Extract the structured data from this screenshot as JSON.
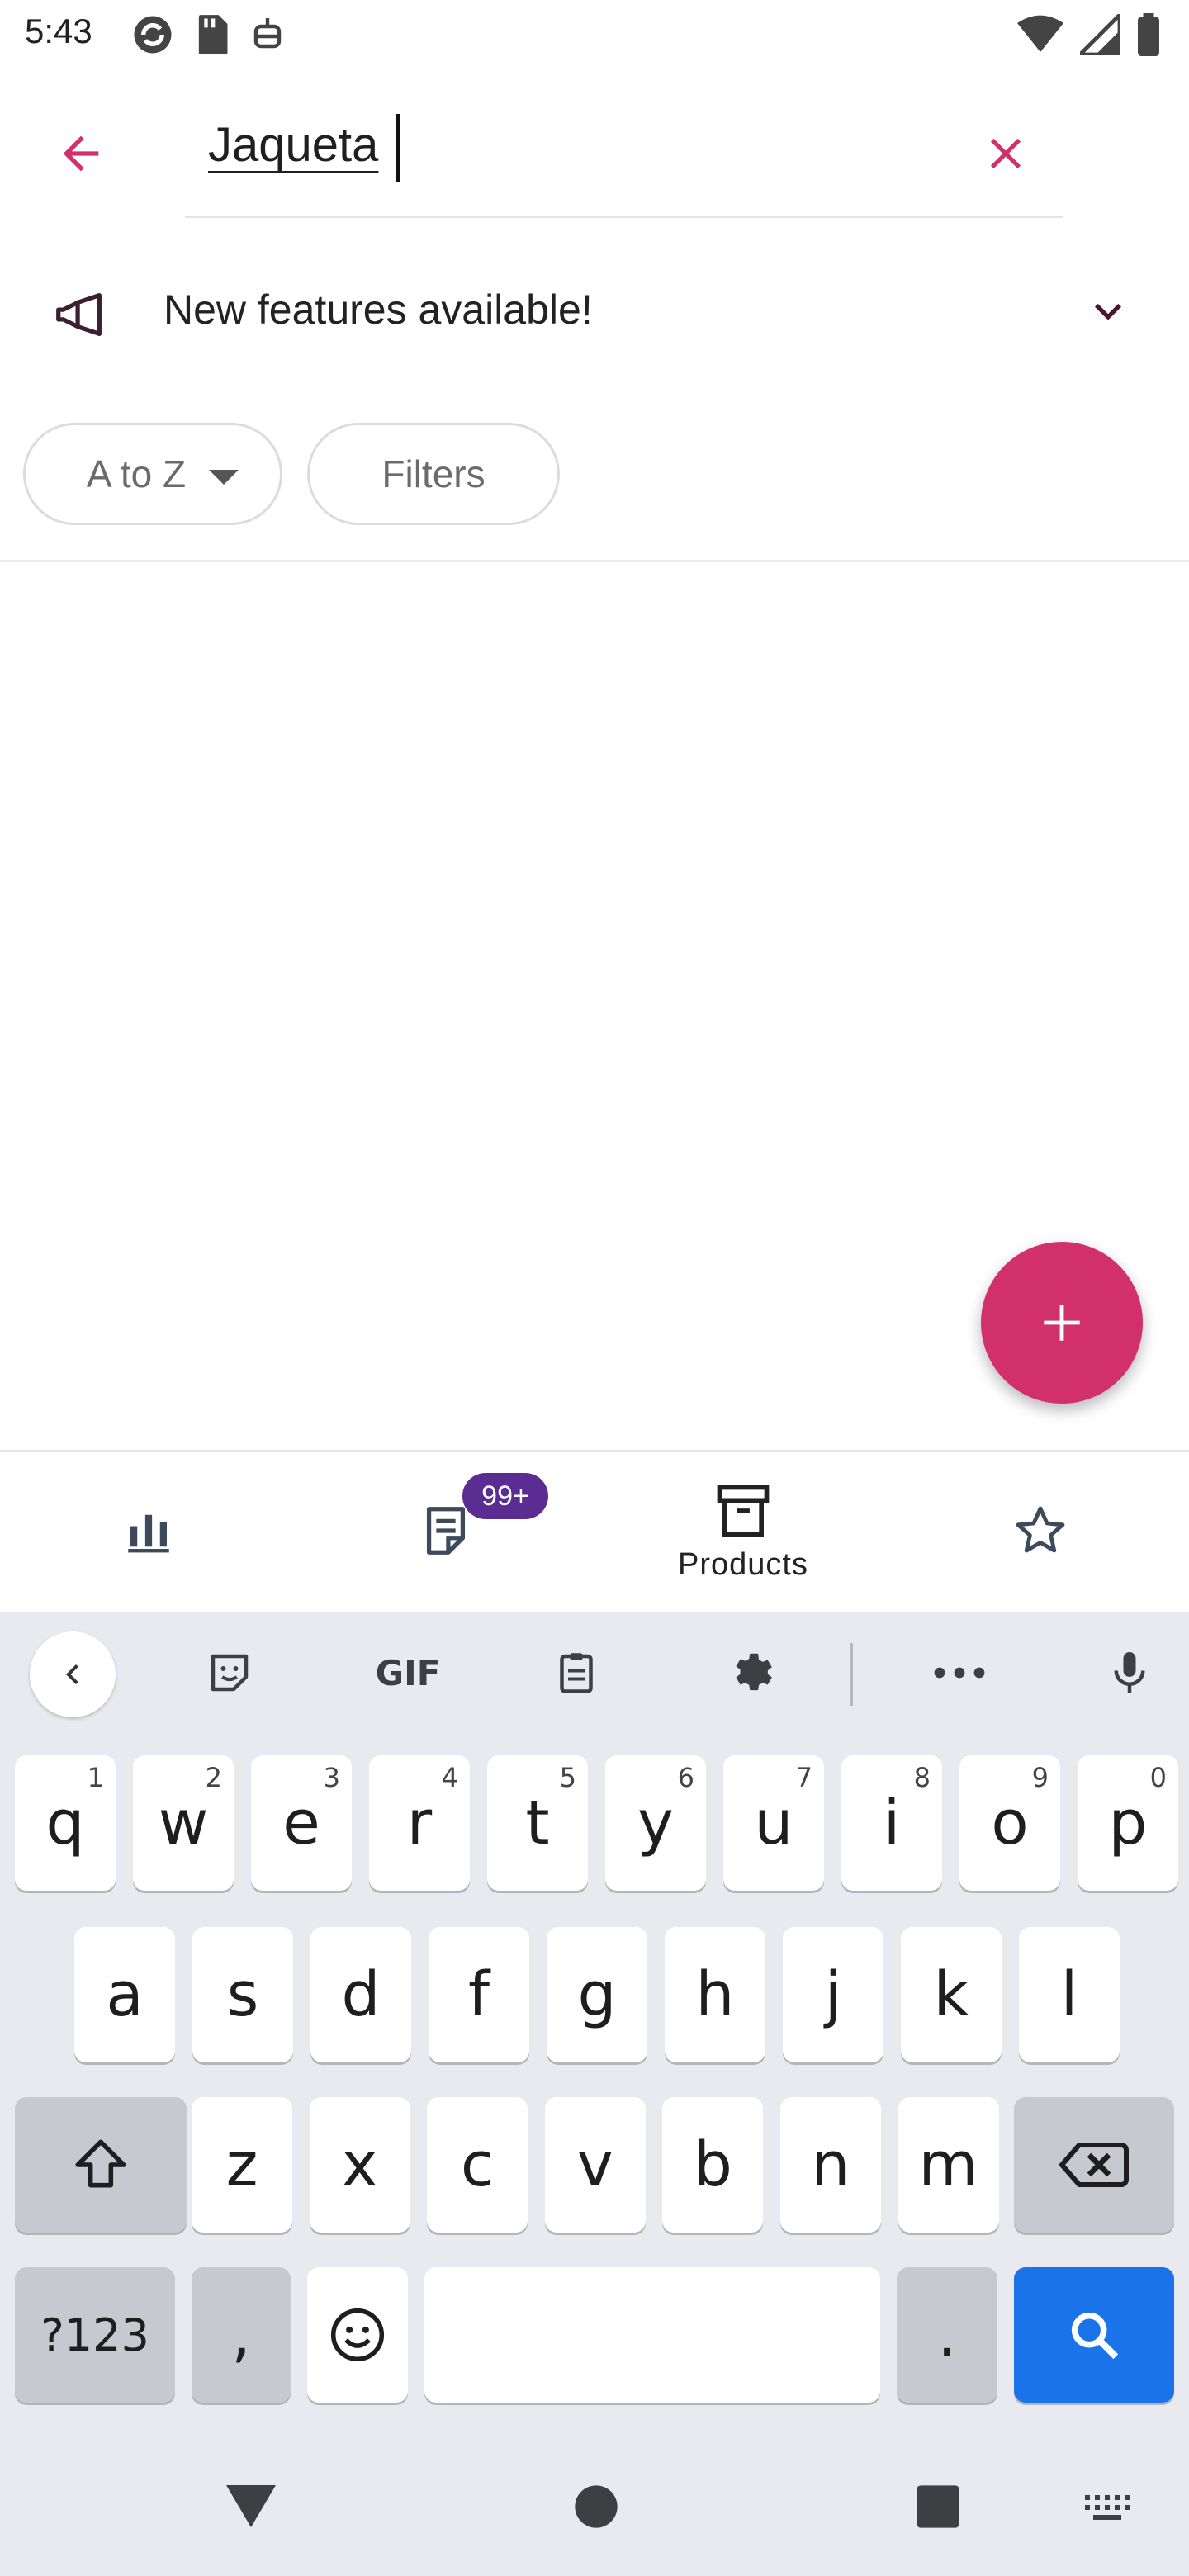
{
  "status_bar": {
    "time": "5:43"
  },
  "search": {
    "query": "Jaqueta"
  },
  "banner": {
    "text": "New features available!"
  },
  "chips": {
    "sort_label": "A to Z",
    "filters_label": "Filters"
  },
  "bottom_nav": {
    "badge": "99+",
    "items": [
      {
        "label": "",
        "icon": "bar-chart-icon"
      },
      {
        "label": "",
        "icon": "orders-icon"
      },
      {
        "label": "Products",
        "icon": "archive-box-icon",
        "selected": true
      },
      {
        "label": "",
        "icon": "star-icon"
      }
    ]
  },
  "keyboard": {
    "toolbar_gif": "GIF",
    "row1": [
      {
        "k": "q",
        "h": "1"
      },
      {
        "k": "w",
        "h": "2"
      },
      {
        "k": "e",
        "h": "3"
      },
      {
        "k": "r",
        "h": "4"
      },
      {
        "k": "t",
        "h": "5"
      },
      {
        "k": "y",
        "h": "6"
      },
      {
        "k": "u",
        "h": "7"
      },
      {
        "k": "i",
        "h": "8"
      },
      {
        "k": "o",
        "h": "9"
      },
      {
        "k": "p",
        "h": "0"
      }
    ],
    "row2": [
      "a",
      "s",
      "d",
      "f",
      "g",
      "h",
      "j",
      "k",
      "l"
    ],
    "row3": [
      "z",
      "x",
      "c",
      "v",
      "b",
      "n",
      "m"
    ],
    "symbols_key": "?123",
    "comma_key": ",",
    "period_key": "."
  },
  "colors": {
    "accent": "#d2306b",
    "badge": "#5b2d92",
    "search_key": "#1a73e8"
  }
}
